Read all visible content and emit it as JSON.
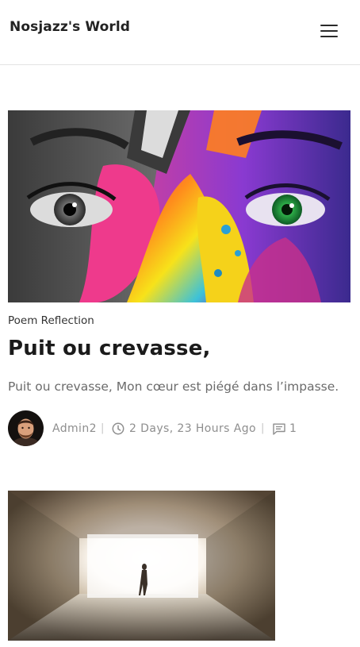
{
  "header": {
    "site_title": "Nosjazz's World",
    "menu_icon": "hamburger-menu-icon"
  },
  "post1": {
    "image_alt": "colorful painted face with eyes",
    "category": "Poem Reflection",
    "title": "Puit ou crevasse,",
    "excerpt": "Puit ou crevasse, Mon cœur est piégé dans l’impasse.",
    "author": "Admin2",
    "date": "2 Days, 23 Hours Ago",
    "comment_count": "1",
    "clock_icon": "clock-icon",
    "comment_icon": "comment-icon",
    "separator": "|"
  },
  "post2": {
    "image_alt": "person walking toward bright light at end of tunnel"
  }
}
